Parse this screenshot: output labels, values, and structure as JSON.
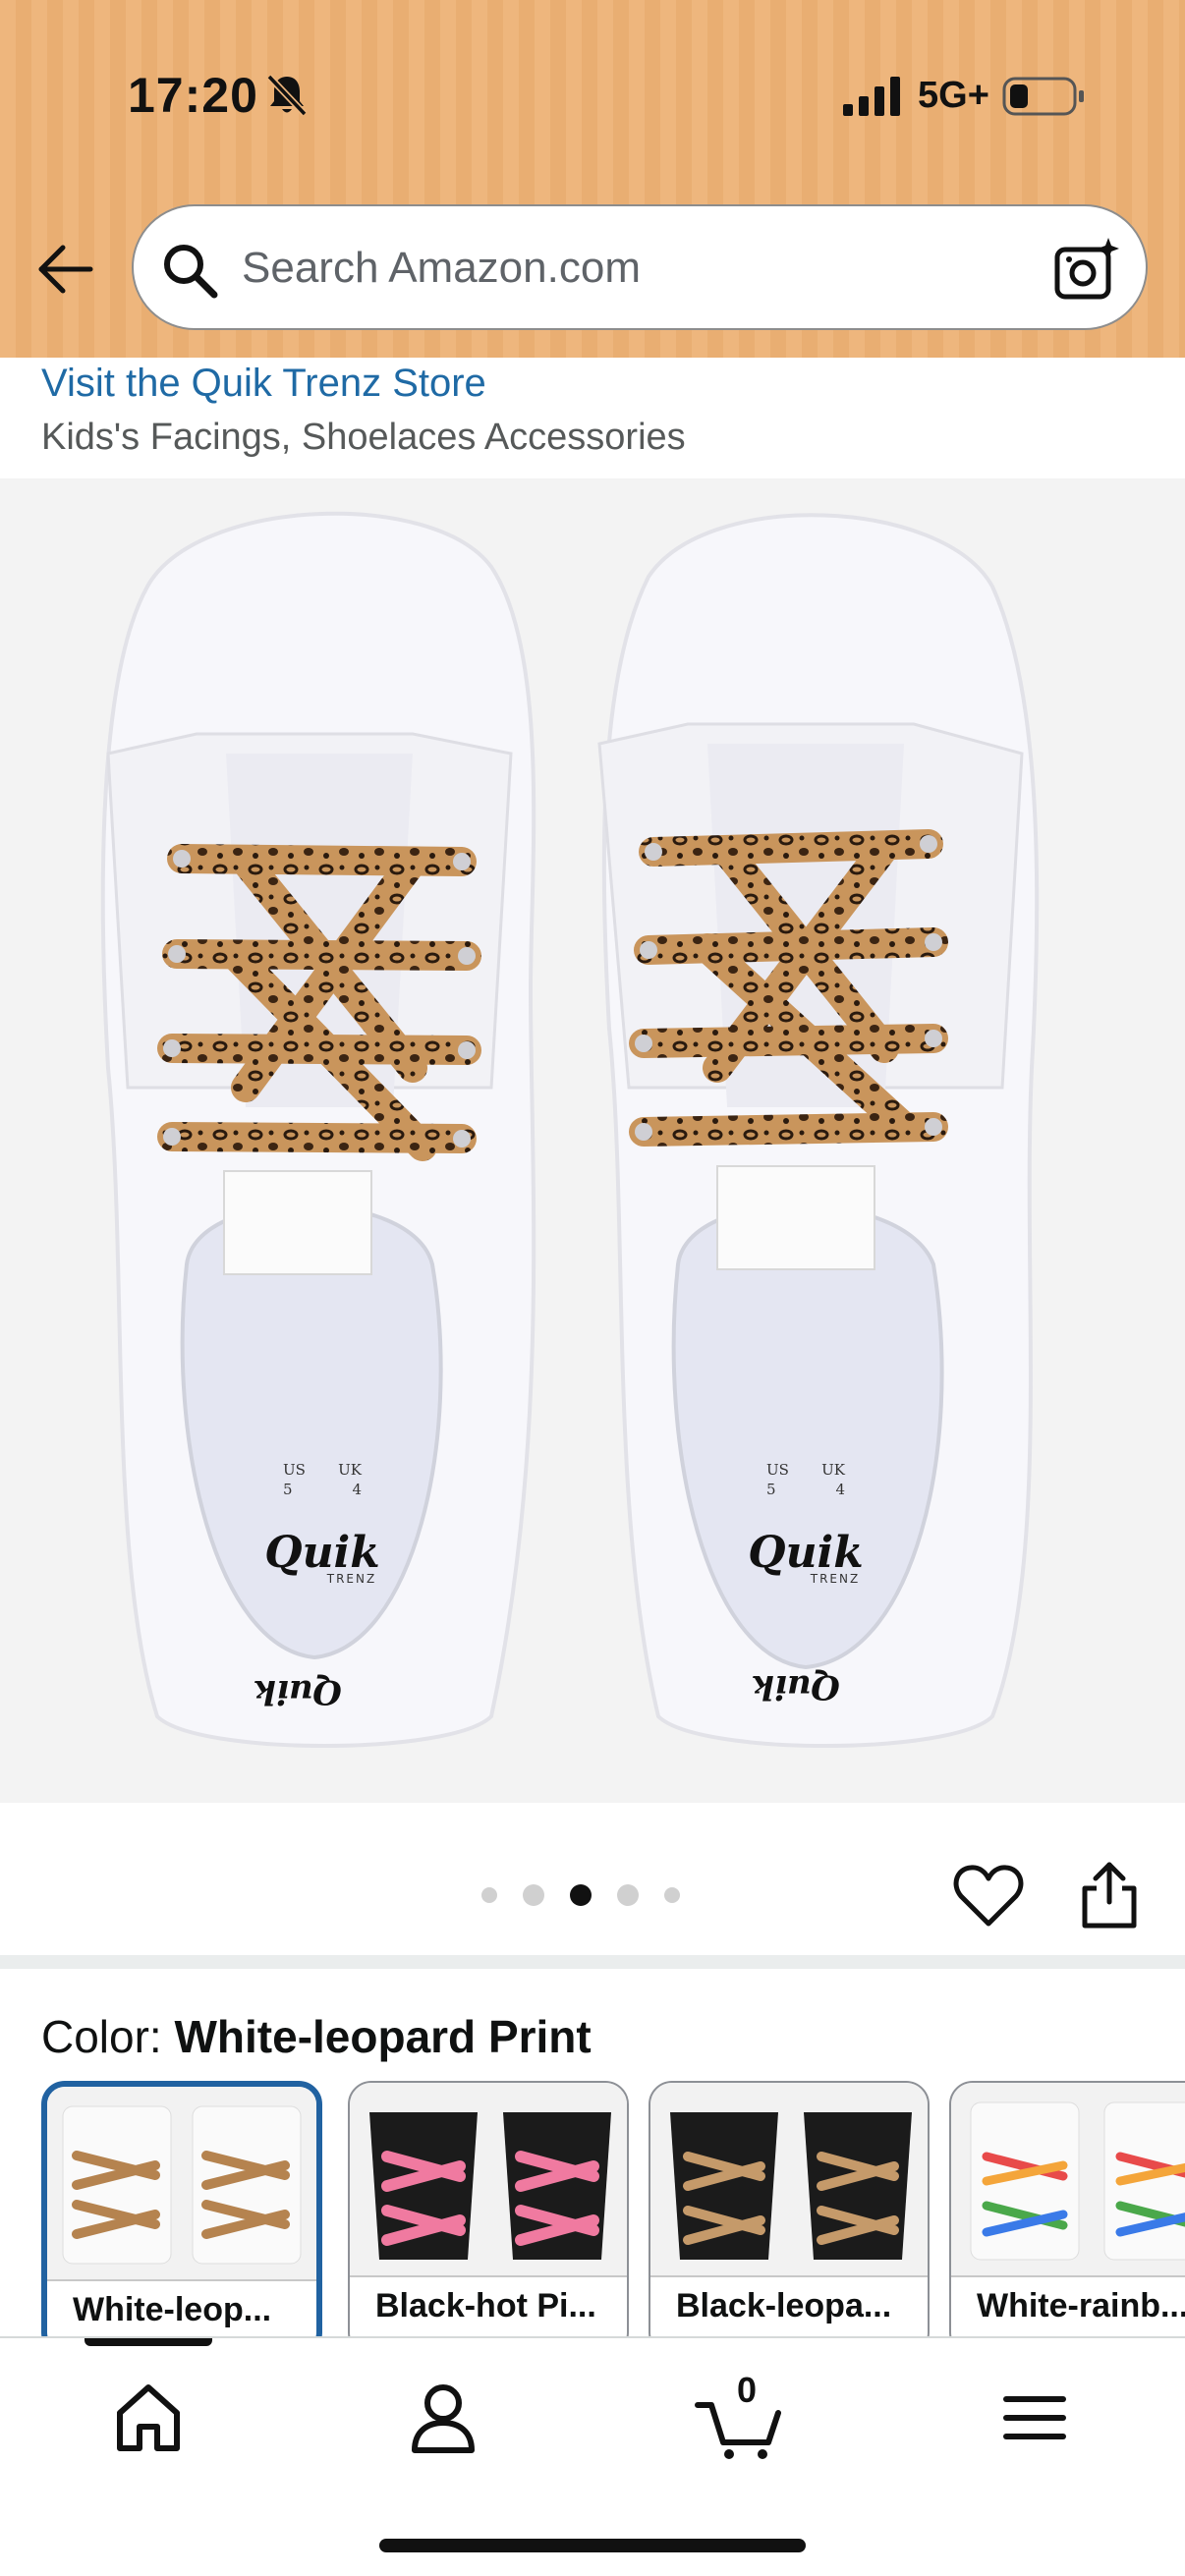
{
  "status_bar": {
    "time": "17:20",
    "network": "5G+"
  },
  "search": {
    "placeholder": "Search Amazon.com"
  },
  "store": {
    "link_text": "Visit the Quik Trenz Store",
    "breadcrumb": "Kids's Facings, Shoelaces Accessories"
  },
  "product_image": {
    "brand_logo_text": "Quik",
    "brand_sub_text": "TRENZ",
    "size_us_label": "US",
    "size_us_value": "5",
    "size_uk_label": "UK",
    "size_uk_value": "4"
  },
  "carousel": {
    "total_images": 5,
    "active_index": 2
  },
  "color": {
    "label": "Color:",
    "selected": "White-leopard Print",
    "options": [
      {
        "label": "White-leop..."
      },
      {
        "label": "Black-hot Pi..."
      },
      {
        "label": "Black-leopa..."
      },
      {
        "label": "White-rainb..."
      }
    ]
  },
  "nav": {
    "cart_count": "0",
    "items": [
      "home-icon",
      "account-icon",
      "cart-icon",
      "menu-icon"
    ]
  },
  "colors": {
    "header_bg": "#eeb67d",
    "link": "#1f6aa5",
    "selected_border": "#2162a1"
  }
}
